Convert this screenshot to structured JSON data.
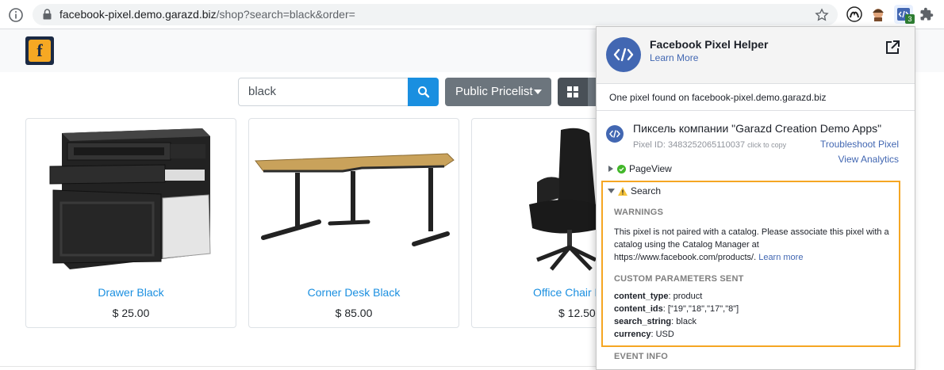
{
  "browser": {
    "url_host": "facebook-pixel.demo.garazd.biz",
    "url_path": "/shop?search=black&order=",
    "extension_badge": "3"
  },
  "header": {
    "logo_letter": "f"
  },
  "search": {
    "value": "black"
  },
  "pricelist_label": "Public Pricelist",
  "products": [
    {
      "name": "Drawer Black",
      "price": "$ 25.00"
    },
    {
      "name": "Corner Desk Black",
      "price": "$ 85.00"
    },
    {
      "name": "Office Chair B",
      "price": "$ 12.50"
    }
  ],
  "pixel_helper": {
    "title": "Facebook Pixel Helper",
    "learn_more": "Learn More",
    "found_text": "One pixel found on facebook-pixel.demo.garazd.biz",
    "pixel_name": "Пиксель компании \"Garazd Creation Demo Apps\"",
    "pixel_id_label": "Pixel ID: 3483252065110037",
    "click_to_copy": "click to copy",
    "troubleshoot": "Troubleshoot Pixel",
    "view_analytics": "View Analytics",
    "events": [
      {
        "name": "PageView",
        "status": "ok"
      },
      {
        "name": "Search",
        "status": "warning"
      }
    ],
    "warnings_heading": "WARNINGS",
    "warning_text": "This pixel is not paired with a catalog. Please associate this pixel with a catalog using the Catalog Manager at https://www.facebook.com/products/.",
    "warning_link": "Learn more",
    "params_heading": "CUSTOM PARAMETERS SENT",
    "params": [
      {
        "key": "content_type",
        "value": ": product"
      },
      {
        "key": "content_ids",
        "value": ": [\"19\",\"18\",\"17\",\"8\"]"
      },
      {
        "key": "search_string",
        "value": ": black"
      },
      {
        "key": "currency",
        "value": ": USD"
      }
    ],
    "event_info_heading": "EVENT INFO"
  }
}
